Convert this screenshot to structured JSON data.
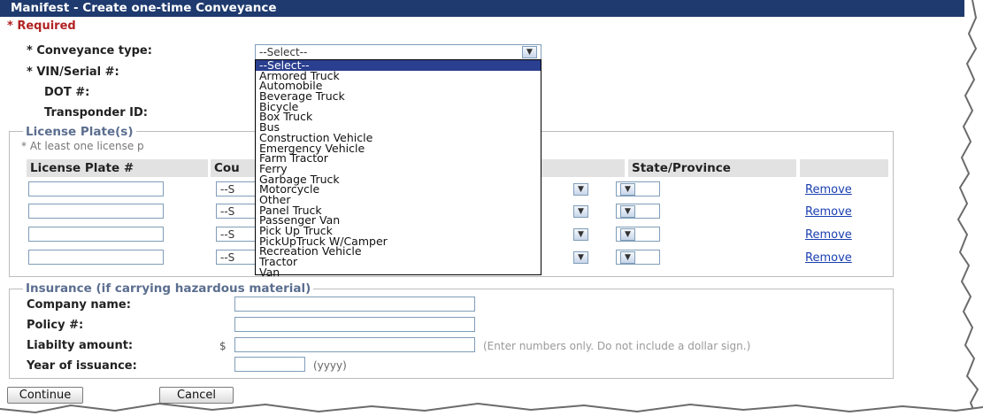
{
  "window": {
    "title": "Manifest - Create one-time Conveyance"
  },
  "required_note": "* Required",
  "fields": {
    "conveyance_type": {
      "label": "* Conveyance type:",
      "value": "--Select--"
    },
    "vin_serial": {
      "label": "* VIN/Serial #:"
    },
    "dot": {
      "label": "DOT #:"
    },
    "transponder": {
      "label": "Transponder ID:"
    }
  },
  "dropdown": {
    "options": [
      "--Select--",
      "Armored Truck",
      "Automobile",
      "Beverage Truck",
      "Bicycle",
      "Box Truck",
      "Bus",
      "Construction Vehicle",
      "Emergency Vehicle",
      "Farm Tractor",
      "Ferry",
      "Garbage Truck",
      "Motorcycle",
      "Other",
      "Panel Truck",
      "Passenger Van",
      "Pick Up Truck",
      "PickUpTruck W/Camper",
      "Recreation Vehicle",
      "Tractor",
      "Van"
    ]
  },
  "license": {
    "legend": "License Plate(s)",
    "note": "* At least one license p",
    "headers": {
      "plate": "License Plate #",
      "country": "Cou",
      "state": "State/Province"
    },
    "country_value": "--S",
    "remove_label": "Remove"
  },
  "insurance": {
    "legend": "Insurance (if carrying hazardous material)",
    "company_label": "Company name:",
    "policy_label": "Policy #:",
    "liability_label": "Liabilty amount:",
    "currency": "$",
    "liability_hint": "(Enter numbers only. Do not include a dollar sign.)",
    "year_label": "Year of issuance:",
    "year_hint": "(yyyy)"
  },
  "buttons": {
    "continue": "Continue",
    "cancel": "Cancel"
  },
  "colors": {
    "titlebar": "#1f3a6e",
    "selection": "#2a3f8f",
    "link": "#1a3fb0",
    "legend": "#5b6e8f"
  }
}
